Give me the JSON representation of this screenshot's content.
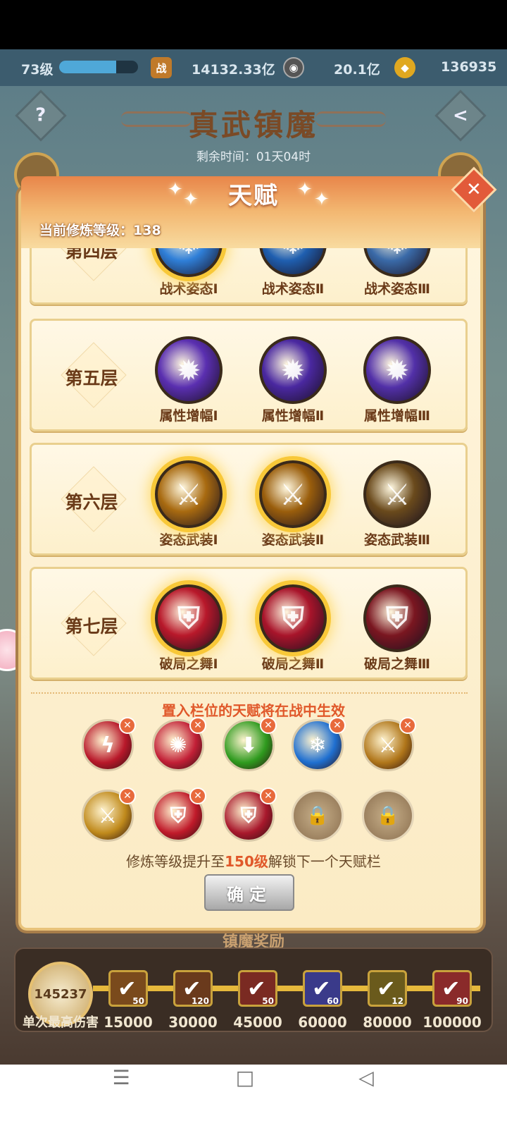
{
  "topbar": {
    "level": "73级",
    "exp_ratio": 0.72,
    "power_icon": "战",
    "power": "14132.33亿",
    "coin": "20.1亿",
    "ingot": "136935"
  },
  "event": {
    "title": "真武镇魔",
    "remaining": "剩余时间：01天04时",
    "help_icon": "?",
    "back_icon": "<",
    "reward_title": "镇魔奖励",
    "max_damage": "145237",
    "max_damage_label": "单次最高伤害",
    "rewards": [
      {
        "threshold": "15000",
        "count": "50"
      },
      {
        "threshold": "30000",
        "count": "120"
      },
      {
        "threshold": "45000",
        "count": "50"
      },
      {
        "threshold": "60000",
        "count": "60"
      },
      {
        "threshold": "80000",
        "count": "12"
      },
      {
        "threshold": "100000",
        "count": "90"
      }
    ]
  },
  "dialog": {
    "title": "天赋",
    "close_icon": "✕",
    "training_level": "当前修炼等级：138",
    "tiers": [
      {
        "name": "第四层",
        "talents": [
          {
            "label": "战术姿态Ⅰ",
            "lit": true
          },
          {
            "label": "战术姿态Ⅱ",
            "lit": false
          },
          {
            "label": "战术姿态Ⅲ",
            "lit": false
          }
        ]
      },
      {
        "name": "第五层",
        "talents": [
          {
            "label": "属性增幅Ⅰ",
            "lit": false
          },
          {
            "label": "属性增幅Ⅱ",
            "lit": false
          },
          {
            "label": "属性增幅Ⅲ",
            "lit": false
          }
        ]
      },
      {
        "name": "第六层",
        "talents": [
          {
            "label": "姿态武装Ⅰ",
            "lit": true
          },
          {
            "label": "姿态武装Ⅱ",
            "lit": true
          },
          {
            "label": "姿态武装Ⅲ",
            "lit": false
          }
        ]
      },
      {
        "name": "第七层",
        "talents": [
          {
            "label": "破局之舞Ⅰ",
            "lit": true
          },
          {
            "label": "破局之舞Ⅱ",
            "lit": true
          },
          {
            "label": "破局之舞Ⅲ",
            "lit": false
          }
        ]
      }
    ],
    "hint": "置入栏位的天赋将在战中生效",
    "slots": [
      {
        "icon": "red-lightning-icon",
        "color": "#b8182a",
        "locked": false
      },
      {
        "icon": "red-swirl-icon",
        "color": "#c21f36",
        "locked": false
      },
      {
        "icon": "green-arrow-icon",
        "color": "#2e9a1e",
        "locked": false
      },
      {
        "icon": "blue-storm-icon",
        "color": "#1f6fd0",
        "locked": false
      },
      {
        "icon": "gold-sword-icon",
        "color": "#b0761a",
        "locked": false
      },
      {
        "icon": "gold-slash-icon",
        "color": "#c08a1c",
        "locked": false
      },
      {
        "icon": "red-shield-icon",
        "color": "#c01a2a",
        "locked": false
      },
      {
        "icon": "red-shield-swirl-icon",
        "color": "#a8182c",
        "locked": false
      },
      {
        "icon": "lock-icon",
        "color": "#9a7a55",
        "locked": true
      },
      {
        "icon": "lock-icon",
        "color": "#9a7a55",
        "locked": true
      }
    ],
    "remove_icon": "✕",
    "lock_glyph": "🔒",
    "unlock_prefix": "修炼等级提升至",
    "unlock_level": "150级",
    "unlock_suffix": "解锁下一个天赋栏",
    "confirm_label": "确定"
  },
  "navbar": {
    "menu_icon": "☰",
    "home_icon": "□",
    "back_icon": "◁"
  }
}
